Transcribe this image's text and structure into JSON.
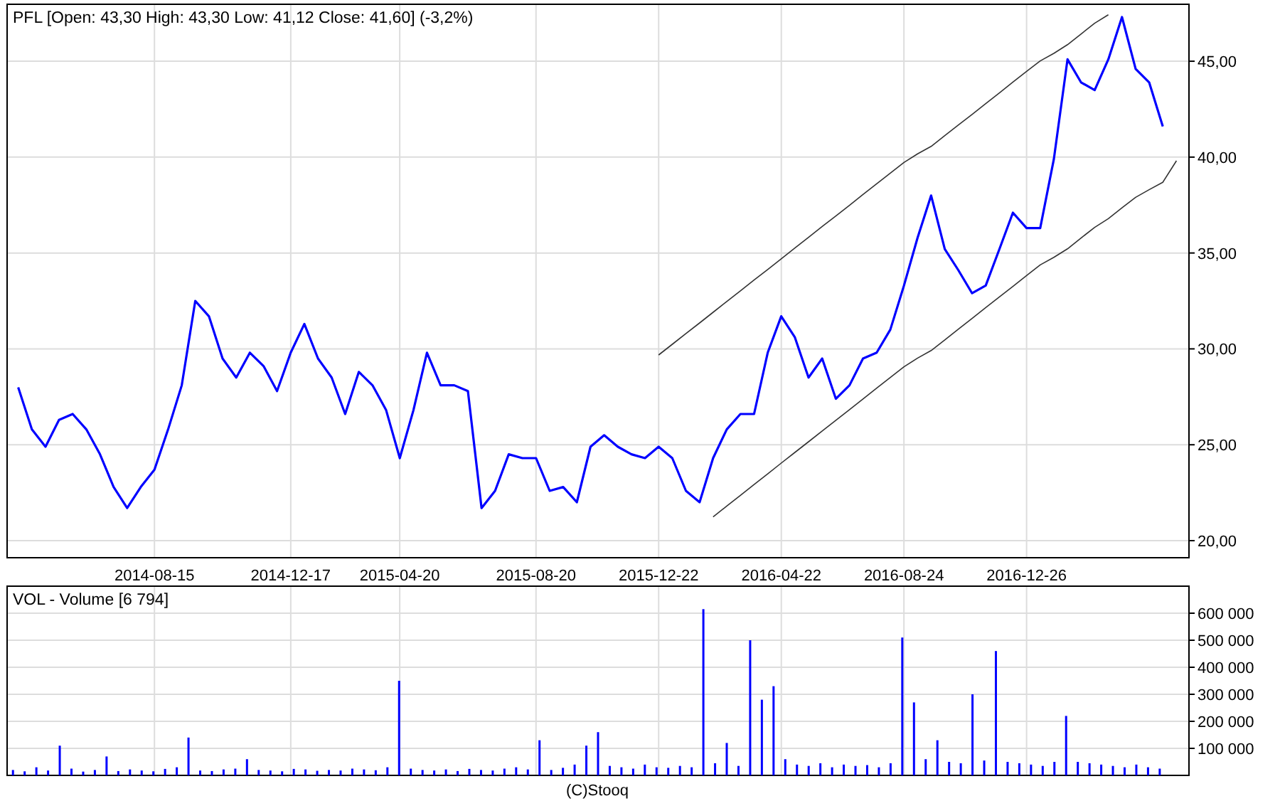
{
  "price_panel": {
    "chart_data": {
      "type": "line",
      "title": "PFL [Open: 43,30  High: 43,30  Low: 41,12  Close: 41,60] (-3,2%)",
      "grid": true,
      "ylim": [
        19.11,
        47.97
      ],
      "categories": [
        null,
        null,
        null,
        null,
        null,
        null,
        null,
        null,
        null,
        null,
        "2014-08-15",
        null,
        null,
        null,
        null,
        null,
        null,
        null,
        null,
        null,
        "2014-12-17",
        null,
        null,
        null,
        null,
        null,
        null,
        null,
        "2015-04-20",
        null,
        null,
        null,
        null,
        null,
        null,
        null,
        null,
        null,
        "2015-08-20",
        null,
        null,
        null,
        null,
        null,
        null,
        null,
        null,
        "2015-12-22",
        null,
        null,
        null,
        null,
        null,
        null,
        null,
        null,
        "2016-04-22",
        null,
        null,
        null,
        null,
        null,
        null,
        null,
        null,
        "2016-08-24",
        null,
        null,
        null,
        null,
        null,
        null,
        null,
        null,
        "2016-12-26",
        null,
        null,
        null,
        null,
        null,
        null,
        null,
        null,
        null,
        null,
        null
      ],
      "yticks": [
        {
          "value": 20,
          "label": "20,00"
        },
        {
          "value": 25,
          "label": "25,00"
        },
        {
          "value": 30,
          "label": "30,00"
        },
        {
          "value": 35,
          "label": "35,00"
        },
        {
          "value": 40,
          "label": "40,00"
        },
        {
          "value": 45,
          "label": "45,00"
        }
      ],
      "series": [
        {
          "color": "#0000ff",
          "values": [
            28.0,
            25.8,
            24.9,
            26.3,
            26.6,
            25.8,
            24.5,
            22.8,
            21.7,
            22.8,
            23.7,
            25.8,
            28.1,
            32.5,
            31.7,
            29.5,
            28.5,
            29.8,
            29.1,
            27.8,
            29.8,
            31.3,
            29.5,
            28.5,
            26.6,
            28.8,
            28.1,
            26.8,
            24.3,
            26.8,
            29.8,
            28.1,
            28.1,
            27.8,
            21.7,
            22.6,
            24.5,
            24.3,
            24.3,
            22.6,
            22.8,
            22.0,
            24.9,
            25.5,
            24.9,
            24.5,
            24.3,
            24.9,
            24.3,
            22.6,
            22.0,
            24.3,
            25.8,
            26.6,
            26.6,
            29.8,
            31.7,
            30.6,
            28.5,
            29.5,
            27.4,
            28.1,
            29.5,
            29.8,
            31.0,
            33.3,
            35.8,
            38.0,
            35.2,
            34.1,
            32.9,
            33.3,
            35.2,
            37.1,
            36.3,
            36.3,
            39.9,
            45.1,
            43.9,
            43.5,
            45.1,
            47.3,
            44.6,
            43.9,
            41.6,
            null
          ]
        },
        {
          "color": "#333333",
          "values": [
            null,
            null,
            null,
            null,
            null,
            null,
            null,
            null,
            null,
            null,
            null,
            null,
            null,
            null,
            null,
            null,
            null,
            null,
            null,
            null,
            null,
            null,
            null,
            null,
            null,
            null,
            null,
            null,
            null,
            null,
            null,
            null,
            null,
            null,
            null,
            null,
            null,
            null,
            null,
            null,
            null,
            null,
            null,
            null,
            null,
            null,
            null,
            29.68,
            30.24,
            30.8,
            31.35,
            31.91,
            32.47,
            33.03,
            33.59,
            34.14,
            34.7,
            35.26,
            35.82,
            36.38,
            36.93,
            37.49,
            38.05,
            38.61,
            39.16,
            39.72,
            40.17,
            40.56,
            41.12,
            41.68,
            42.23,
            42.79,
            43.35,
            43.91,
            44.47,
            45.02,
            45.41,
            45.86,
            46.42,
            46.98,
            47.42,
            null,
            null,
            null,
            null,
            null
          ]
        },
        {
          "color": "#333333",
          "values": [
            null,
            null,
            null,
            null,
            null,
            null,
            null,
            null,
            null,
            null,
            null,
            null,
            null,
            null,
            null,
            null,
            null,
            null,
            null,
            null,
            null,
            null,
            null,
            null,
            null,
            null,
            null,
            null,
            null,
            null,
            null,
            null,
            null,
            null,
            null,
            null,
            null,
            null,
            null,
            null,
            null,
            null,
            null,
            null,
            null,
            null,
            null,
            null,
            null,
            null,
            null,
            21.24,
            21.8,
            22.36,
            22.92,
            23.48,
            24.04,
            24.6,
            25.16,
            25.72,
            26.28,
            26.83,
            27.39,
            27.95,
            28.51,
            29.07,
            29.52,
            29.91,
            30.47,
            31.03,
            31.59,
            32.15,
            32.71,
            33.26,
            33.82,
            34.38,
            34.77,
            35.22,
            35.78,
            36.34,
            36.79,
            37.35,
            37.9,
            38.3,
            38.69,
            39.81
          ]
        }
      ]
    }
  },
  "volume_panel": {
    "chart_data": {
      "type": "bar",
      "title": "VOL - Volume [6 794]",
      "grid": true,
      "ylim": [
        0,
        700000
      ],
      "yticks": [
        {
          "value": 100000,
          "label": "100 000"
        },
        {
          "value": 200000,
          "label": "200 000"
        },
        {
          "value": 300000,
          "label": "300 000"
        },
        {
          "value": 400000,
          "label": "400 000"
        },
        {
          "value": 500000,
          "label": "500 000"
        },
        {
          "value": 600000,
          "label": "600 000"
        }
      ],
      "series": [
        {
          "color": "#0000ff",
          "values": [
            20000,
            15000,
            30000,
            18000,
            110000,
            25000,
            14000,
            20000,
            70000,
            16000,
            22000,
            18000,
            15000,
            24000,
            30000,
            140000,
            18000,
            16000,
            22000,
            25000,
            60000,
            20000,
            18000,
            15000,
            24000,
            22000,
            17000,
            20000,
            18000,
            25000,
            22000,
            19000,
            30000,
            350000,
            25000,
            20000,
            18000,
            22000,
            16000,
            24000,
            20000,
            18000,
            25000,
            30000,
            22000,
            130000,
            20000,
            28000,
            40000,
            110000,
            160000,
            35000,
            30000,
            25000,
            40000,
            30000,
            28000,
            35000,
            30000,
            615000,
            45000,
            120000,
            35000,
            500000,
            280000,
            330000,
            60000,
            40000,
            35000,
            45000,
            30000,
            40000,
            35000,
            38000,
            30000,
            45000,
            510000,
            270000,
            60000,
            130000,
            50000,
            45000,
            300000,
            55000,
            460000,
            50000,
            45000,
            40000,
            35000,
            50000,
            220000,
            50000,
            45000,
            40000,
            35000,
            30000,
            40000,
            30000,
            25000,
            null,
            null
          ]
        }
      ]
    }
  },
  "footer": {
    "text": "(C)Stooq"
  }
}
